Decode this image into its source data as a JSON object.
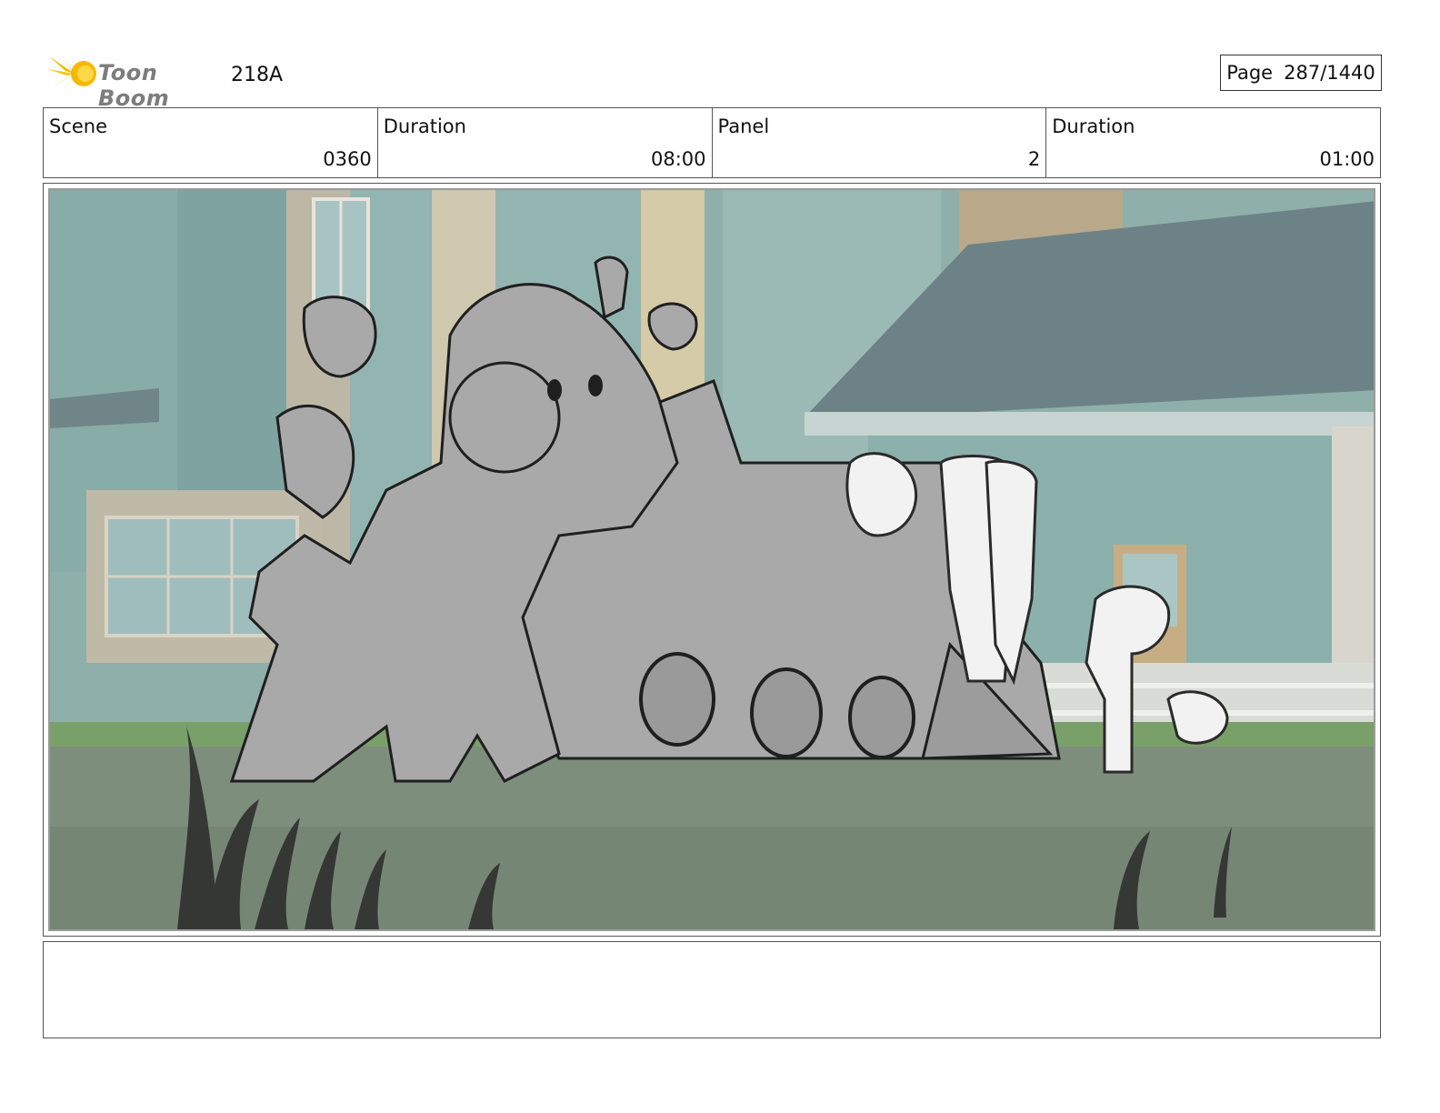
{
  "header": {
    "logo_text": "Toon Boom",
    "project_id": "218A",
    "page_label": "Page",
    "page_number": "287/1440"
  },
  "info": {
    "scene_label": "Scene",
    "scene_value": "0360",
    "scene_duration_label": "Duration",
    "scene_duration_value": "08:00",
    "panel_label": "Panel",
    "panel_value": "2",
    "panel_duration_label": "Duration",
    "panel_duration_value": "01:00"
  },
  "panel": {
    "image_subject": "storyboard-sketch-farm-train"
  },
  "notes": {
    "text": ""
  }
}
